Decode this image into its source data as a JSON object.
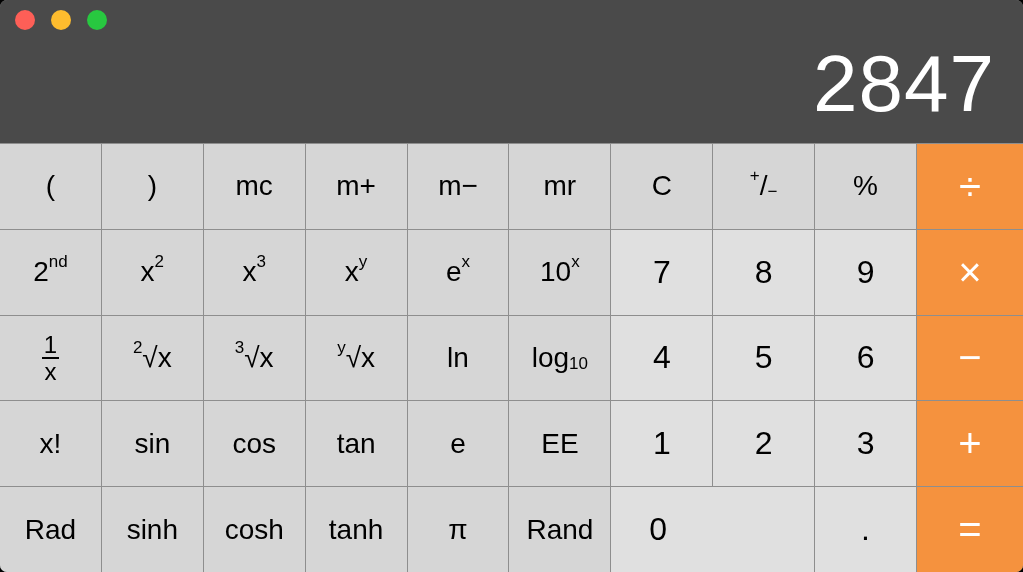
{
  "window": {
    "traffic_lights": [
      {
        "color": "#fe5f57"
      },
      {
        "color": "#febc2e"
      },
      {
        "color": "#28c840"
      }
    ]
  },
  "display": "2847",
  "keys": [
    {
      "label": "(",
      "kind": "function"
    },
    {
      "label": ")",
      "kind": "function"
    },
    {
      "label": "mc",
      "kind": "function"
    },
    {
      "label": "m+",
      "kind": "function"
    },
    {
      "label": "m−",
      "kind": "function"
    },
    {
      "label": "mr",
      "kind": "function"
    },
    {
      "label": "C",
      "kind": "function"
    },
    {
      "label": "$^{+}$/$_{−}$",
      "kind": "function"
    },
    {
      "label": "%",
      "kind": "function"
    },
    {
      "label": "÷",
      "kind": "operator"
    },
    {
      "label": "2$^{nd}$",
      "kind": "function"
    },
    {
      "label": "x$^{2}$",
      "kind": "function"
    },
    {
      "label": "x$^{3}$",
      "kind": "function"
    },
    {
      "label": "x$^{y}$",
      "kind": "function"
    },
    {
      "label": "e$^{x}$",
      "kind": "function"
    },
    {
      "label": "10$^{x}$",
      "kind": "function"
    },
    {
      "label": "7",
      "kind": "digit"
    },
    {
      "label": "8",
      "kind": "digit"
    },
    {
      "label": "9",
      "kind": "digit"
    },
    {
      "label": "×",
      "kind": "operator"
    },
    {
      "numerator": "1",
      "denominator": "x",
      "kind": "fraction"
    },
    {
      "label": "$^{2}$√x",
      "kind": "function"
    },
    {
      "label": "$^{3}$√x",
      "kind": "function"
    },
    {
      "label": "$^{y}$√x",
      "kind": "function"
    },
    {
      "label": "ln",
      "kind": "function"
    },
    {
      "label": "log$_{10}$",
      "kind": "function"
    },
    {
      "label": "4",
      "kind": "digit"
    },
    {
      "label": "5",
      "kind": "digit"
    },
    {
      "label": "6",
      "kind": "digit"
    },
    {
      "label": "−",
      "kind": "operator"
    },
    {
      "label": "x!",
      "kind": "function"
    },
    {
      "label": "sin",
      "kind": "function"
    },
    {
      "label": "cos",
      "kind": "function"
    },
    {
      "label": "tan",
      "kind": "function"
    },
    {
      "label": "e",
      "kind": "function"
    },
    {
      "label": "EE",
      "kind": "function"
    },
    {
      "label": "1",
      "kind": "digit"
    },
    {
      "label": "2",
      "kind": "digit"
    },
    {
      "label": "3",
      "kind": "digit"
    },
    {
      "label": "+",
      "kind": "operator"
    },
    {
      "label": "Rad",
      "kind": "function"
    },
    {
      "label": "sinh",
      "kind": "function"
    },
    {
      "label": "cosh",
      "kind": "function"
    },
    {
      "label": "tanh",
      "kind": "function"
    },
    {
      "label": "π",
      "kind": "function"
    },
    {
      "label": "Rand",
      "kind": "function"
    },
    {
      "label": "0",
      "kind": "wide-digit"
    },
    {
      "label": ".",
      "kind": "digit"
    },
    {
      "label": "=",
      "kind": "operator"
    }
  ]
}
